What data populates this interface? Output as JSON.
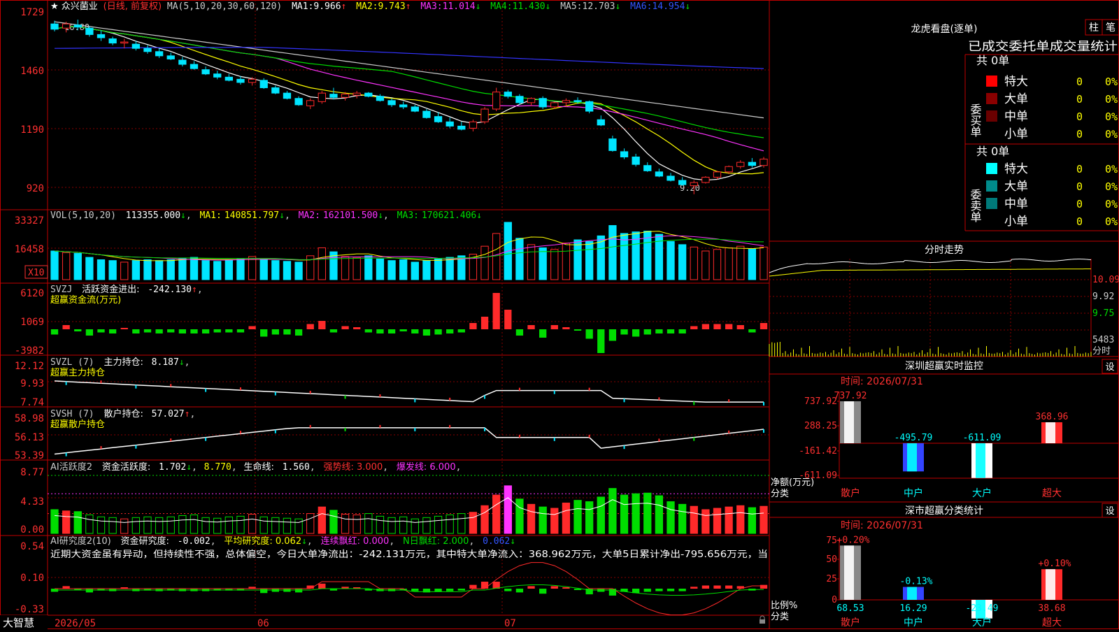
{
  "app": {
    "brand": "大智慧",
    "tab_zhu": "柱",
    "tab_bi": "笔"
  },
  "colors": {
    "up": "#ff2a2a",
    "down": "#00e5ff",
    "green": "#00dd00",
    "yellow": "#ffff00",
    "magenta": "#ff33ff",
    "grid": "#b00000",
    "frame": "#c00000"
  },
  "kline": {
    "stock": "众兴菌业",
    "period": "(日线, 前复权)",
    "ma_label": "MA(5,10,20,30,60,120)",
    "ma": [
      {
        "label": "MA1:",
        "value": "9.966",
        "arrow": "↑",
        "color": "#ffffff"
      },
      {
        "label": "MA2:",
        "value": "9.743",
        "arrow": "↑",
        "color": "#ffff00"
      },
      {
        "label": "MA3:",
        "value": "11.014",
        "arrow": "↓",
        "color": "#ff33ff"
      },
      {
        "label": "MA4:",
        "value": "11.430",
        "arrow": "↓",
        "color": "#00dd00"
      },
      {
        "label": "MA5:",
        "value": "12.703",
        "arrow": "↓",
        "color": "#cccccc"
      },
      {
        "label": "MA6:",
        "value": "14.954",
        "arrow": "↓",
        "color": "#3333ff"
      }
    ],
    "axis": [
      "1729",
      "1460",
      "1190",
      "920"
    ],
    "high_mark": "16.80",
    "low_mark": "9.20"
  },
  "vol": {
    "label": "VOL(5,10,20)",
    "value": "113355.000",
    "arrow": "↓",
    "ma": [
      {
        "label": "MA1:",
        "value": "140851.797",
        "arrow": "↓",
        "color": "#ffff00"
      },
      {
        "label": "MA2:",
        "value": "162101.500",
        "arrow": "↓",
        "color": "#ff33ff"
      },
      {
        "label": "MA3:",
        "value": "170621.406",
        "arrow": "↓",
        "color": "#00dd00"
      }
    ],
    "axis": [
      "33327",
      "16458"
    ],
    "unit": "X10"
  },
  "svzj": {
    "label": "SVZJ",
    "title": "活跃资金进出:",
    "value": "-242.130",
    "arrow": "↑",
    "sub": "超赢资金流(万元)",
    "axis": [
      "6120",
      "1069",
      "-3982"
    ]
  },
  "svzl": {
    "label": "SVZL (7)",
    "title": "主力持仓:",
    "value": "8.187",
    "arrow": "↓",
    "sub": "超赢主力持仓",
    "axis": [
      "12.12",
      "9.93",
      "7.74"
    ]
  },
  "svsh": {
    "label": "SVSH (7)",
    "title": "散户持仓:",
    "value": "57.027",
    "arrow": "↑",
    "sub": "超赢散户持仓",
    "axis": [
      "58.98",
      "56.13",
      "53.39"
    ]
  },
  "ai1": {
    "label": "AI活跃度2",
    "title": "资金活跃度:",
    "value": "1.702",
    "arrow": "↓",
    "value2": "8.770",
    "life_label": "生命线:",
    "life_value": "1.560",
    "strong": "强势线: 3.000",
    "burst": "爆发线: 6.000",
    "axis": [
      "8.77",
      "4.33",
      "0.00"
    ]
  },
  "ai2": {
    "label": "AI研究度2(10)",
    "title": "资金研究度:",
    "value": "-0.002",
    "avg": "平均研究度: 0.062",
    "red": "连续飘红: 0.000",
    "nred": "N日飘红: 2.000",
    "extra": "0.062",
    "commentary": "近期大资金虽有异动，但持续性不强，总体偏空，今日大单净流出：-242.131万元，其中特大单净流入：368.962万元，大单5日累计净出-795.656万元，当",
    "axis": [
      "0.54",
      "0.10",
      "-0.33"
    ]
  },
  "xaxis": [
    "2026/05",
    "06",
    "07"
  ],
  "lhb": {
    "title": "龙虎看盘(逐单)",
    "header": "已成交委托单成交量统计",
    "buy": {
      "side": "委买单",
      "total": "共 0单",
      "rows": [
        {
          "name": "特大",
          "count": "0",
          "pct": "0%",
          "color": "#ff0000"
        },
        {
          "name": "大单",
          "count": "0",
          "pct": "0%",
          "color": "#8a0000"
        },
        {
          "name": "中单",
          "count": "0",
          "pct": "0%",
          "color": "#6a0000"
        },
        {
          "name": "小单",
          "count": "0",
          "pct": "0%",
          "color": ""
        }
      ]
    },
    "sell": {
      "side": "委卖单",
      "total": "共 0单",
      "rows": [
        {
          "name": "特大",
          "count": "0",
          "pct": "0%",
          "color": "#00ffff"
        },
        {
          "name": "大单",
          "count": "0",
          "pct": "0%",
          "color": "#008b8b"
        },
        {
          "name": "中单",
          "count": "0",
          "pct": "0%",
          "color": "#007a7a"
        },
        {
          "name": "小单",
          "count": "0",
          "pct": "0%",
          "color": ""
        }
      ]
    }
  },
  "fenshi": {
    "title": "分时走势",
    "axis": [
      "10.09",
      "9.92",
      "9.75"
    ],
    "vol_axis": "5483",
    "vol_label": "分时"
  },
  "sz_monitor": {
    "title": "深圳超赢实时监控",
    "set": "设",
    "time": "时间: 2026/07/31",
    "axis": [
      "737.92",
      "288.25",
      "-161.42",
      "-611.09"
    ],
    "y_label": "净额(万元)",
    "x_label": "分类",
    "bars": [
      {
        "name": "散户",
        "value": 737.92,
        "label": "737.92"
      },
      {
        "name": "中户",
        "value": -495.79,
        "label": "-495.79"
      },
      {
        "name": "大户",
        "value": -611.09,
        "label": "-611.09"
      },
      {
        "name": "超大",
        "value": 368.96,
        "label": "368.96"
      }
    ]
  },
  "ss_stat": {
    "title": "深市超赢分类统计",
    "set": "设",
    "time": "时间: 2026/07/31",
    "axis": [
      "75",
      "50",
      "25",
      "0"
    ],
    "y_label": "比例%",
    "x_label": "分类",
    "bars": [
      {
        "name": "散户",
        "value": 68.53,
        "label": "68.53",
        "delta": "+0.20%"
      },
      {
        "name": "中户",
        "value": 16.29,
        "label": "16.29",
        "delta": "-0.13%"
      },
      {
        "name": "大户",
        "value": -23.49,
        "label": "-23.49",
        "delta": ""
      },
      {
        "name": "超大",
        "value": 38.68,
        "label": "38.68",
        "delta": "+0.10%"
      }
    ]
  },
  "chart_data": {
    "type": "candlestick",
    "title": "众兴菌业",
    "ohlc": [
      [
        17.2,
        17.35,
        16.85,
        16.95
      ],
      [
        17.0,
        17.3,
        16.8,
        17.2
      ],
      [
        17.15,
        17.4,
        16.9,
        17.05
      ],
      [
        17.0,
        17.1,
        16.6,
        16.7
      ],
      [
        16.7,
        16.9,
        16.4,
        16.55
      ],
      [
        16.5,
        16.6,
        16.2,
        16.3
      ],
      [
        16.3,
        16.5,
        16.05,
        16.35
      ],
      [
        16.25,
        16.4,
        15.95,
        16.05
      ],
      [
        16.05,
        16.2,
        15.8,
        15.9
      ],
      [
        15.9,
        16.05,
        15.6,
        15.7
      ],
      [
        15.7,
        15.85,
        15.5,
        15.55
      ],
      [
        15.5,
        15.65,
        15.2,
        15.3
      ],
      [
        15.3,
        15.45,
        15.05,
        15.1
      ],
      [
        15.05,
        15.2,
        14.8,
        14.85
      ],
      [
        14.85,
        15.0,
        14.6,
        14.7
      ],
      [
        14.7,
        14.85,
        14.5,
        14.55
      ],
      [
        14.6,
        14.75,
        14.35,
        14.45
      ],
      [
        14.45,
        14.7,
        14.3,
        14.6
      ],
      [
        14.55,
        14.65,
        14.15,
        14.2
      ],
      [
        14.2,
        14.3,
        13.9,
        13.95
      ],
      [
        13.95,
        14.05,
        13.65,
        13.7
      ],
      [
        13.7,
        13.8,
        13.35,
        13.4
      ],
      [
        13.35,
        13.7,
        13.2,
        13.6
      ],
      [
        13.55,
        14.05,
        13.45,
        13.95
      ],
      [
        13.9,
        14.2,
        13.65,
        13.75
      ],
      [
        13.75,
        14.0,
        13.6,
        13.9
      ],
      [
        13.85,
        14.05,
        13.7,
        13.95
      ],
      [
        13.95,
        14.0,
        13.75,
        13.8
      ],
      [
        13.8,
        13.9,
        13.55,
        13.6
      ],
      [
        13.6,
        13.7,
        13.3,
        13.4
      ],
      [
        13.4,
        13.55,
        13.2,
        13.3
      ],
      [
        13.3,
        13.4,
        13.05,
        13.1
      ],
      [
        13.1,
        13.2,
        12.75,
        12.8
      ],
      [
        12.85,
        13.05,
        12.55,
        12.6
      ],
      [
        12.6,
        12.8,
        12.3,
        12.4
      ],
      [
        12.4,
        12.6,
        12.2,
        12.25
      ],
      [
        12.3,
        12.7,
        12.15,
        12.6
      ],
      [
        12.6,
        13.3,
        12.5,
        13.2
      ],
      [
        13.2,
        14.2,
        13.1,
        14.0
      ],
      [
        14.0,
        14.1,
        13.7,
        13.8
      ],
      [
        13.8,
        13.9,
        13.4,
        13.5
      ],
      [
        13.5,
        13.75,
        13.35,
        13.7
      ],
      [
        13.7,
        13.8,
        13.2,
        13.3
      ],
      [
        13.3,
        13.55,
        13.2,
        13.5
      ],
      [
        13.5,
        13.7,
        13.3,
        13.6
      ],
      [
        13.6,
        13.75,
        13.45,
        13.55
      ],
      [
        13.55,
        13.6,
        13.0,
        13.1
      ],
      [
        12.7,
        12.9,
        12.4,
        12.45
      ],
      [
        11.8,
        11.95,
        11.2,
        11.25
      ],
      [
        11.2,
        11.35,
        10.85,
        10.95
      ],
      [
        10.95,
        11.1,
        10.5,
        10.6
      ],
      [
        10.55,
        10.7,
        10.25,
        10.3
      ],
      [
        10.25,
        10.4,
        10.0,
        10.05
      ],
      [
        10.05,
        10.2,
        9.8,
        9.85
      ],
      [
        9.85,
        10.0,
        9.6,
        9.65
      ],
      [
        9.6,
        9.85,
        9.2,
        9.75
      ],
      [
        9.75,
        10.05,
        9.7,
        10.0
      ],
      [
        10.0,
        10.3,
        9.9,
        10.25
      ],
      [
        10.25,
        10.55,
        10.15,
        10.5
      ],
      [
        10.5,
        10.8,
        10.4,
        10.7
      ],
      [
        10.7,
        10.9,
        10.45,
        10.55
      ],
      [
        10.55,
        10.95,
        10.45,
        10.85
      ]
    ],
    "volume": [
      36,
      34,
      33,
      28,
      25,
      24,
      22,
      24,
      25,
      24,
      25,
      27,
      28,
      24,
      23,
      25,
      26,
      29,
      25,
      24,
      23,
      22,
      30,
      40,
      35,
      29,
      28,
      30,
      26,
      24,
      25,
      22,
      24,
      26,
      28,
      30,
      32,
      42,
      58,
      72,
      52,
      44,
      40,
      38,
      46,
      50,
      48,
      55,
      68,
      58,
      60,
      61,
      57,
      48,
      44,
      41,
      36,
      38,
      40,
      42,
      39,
      41
    ],
    "ma_current": {
      "MA1": 9.966,
      "MA2": 9.743,
      "MA3": 11.014,
      "MA4": 11.43,
      "MA5": 12.703,
      "MA6": 14.954
    },
    "ylim": [
      8.8,
      17.6
    ]
  }
}
